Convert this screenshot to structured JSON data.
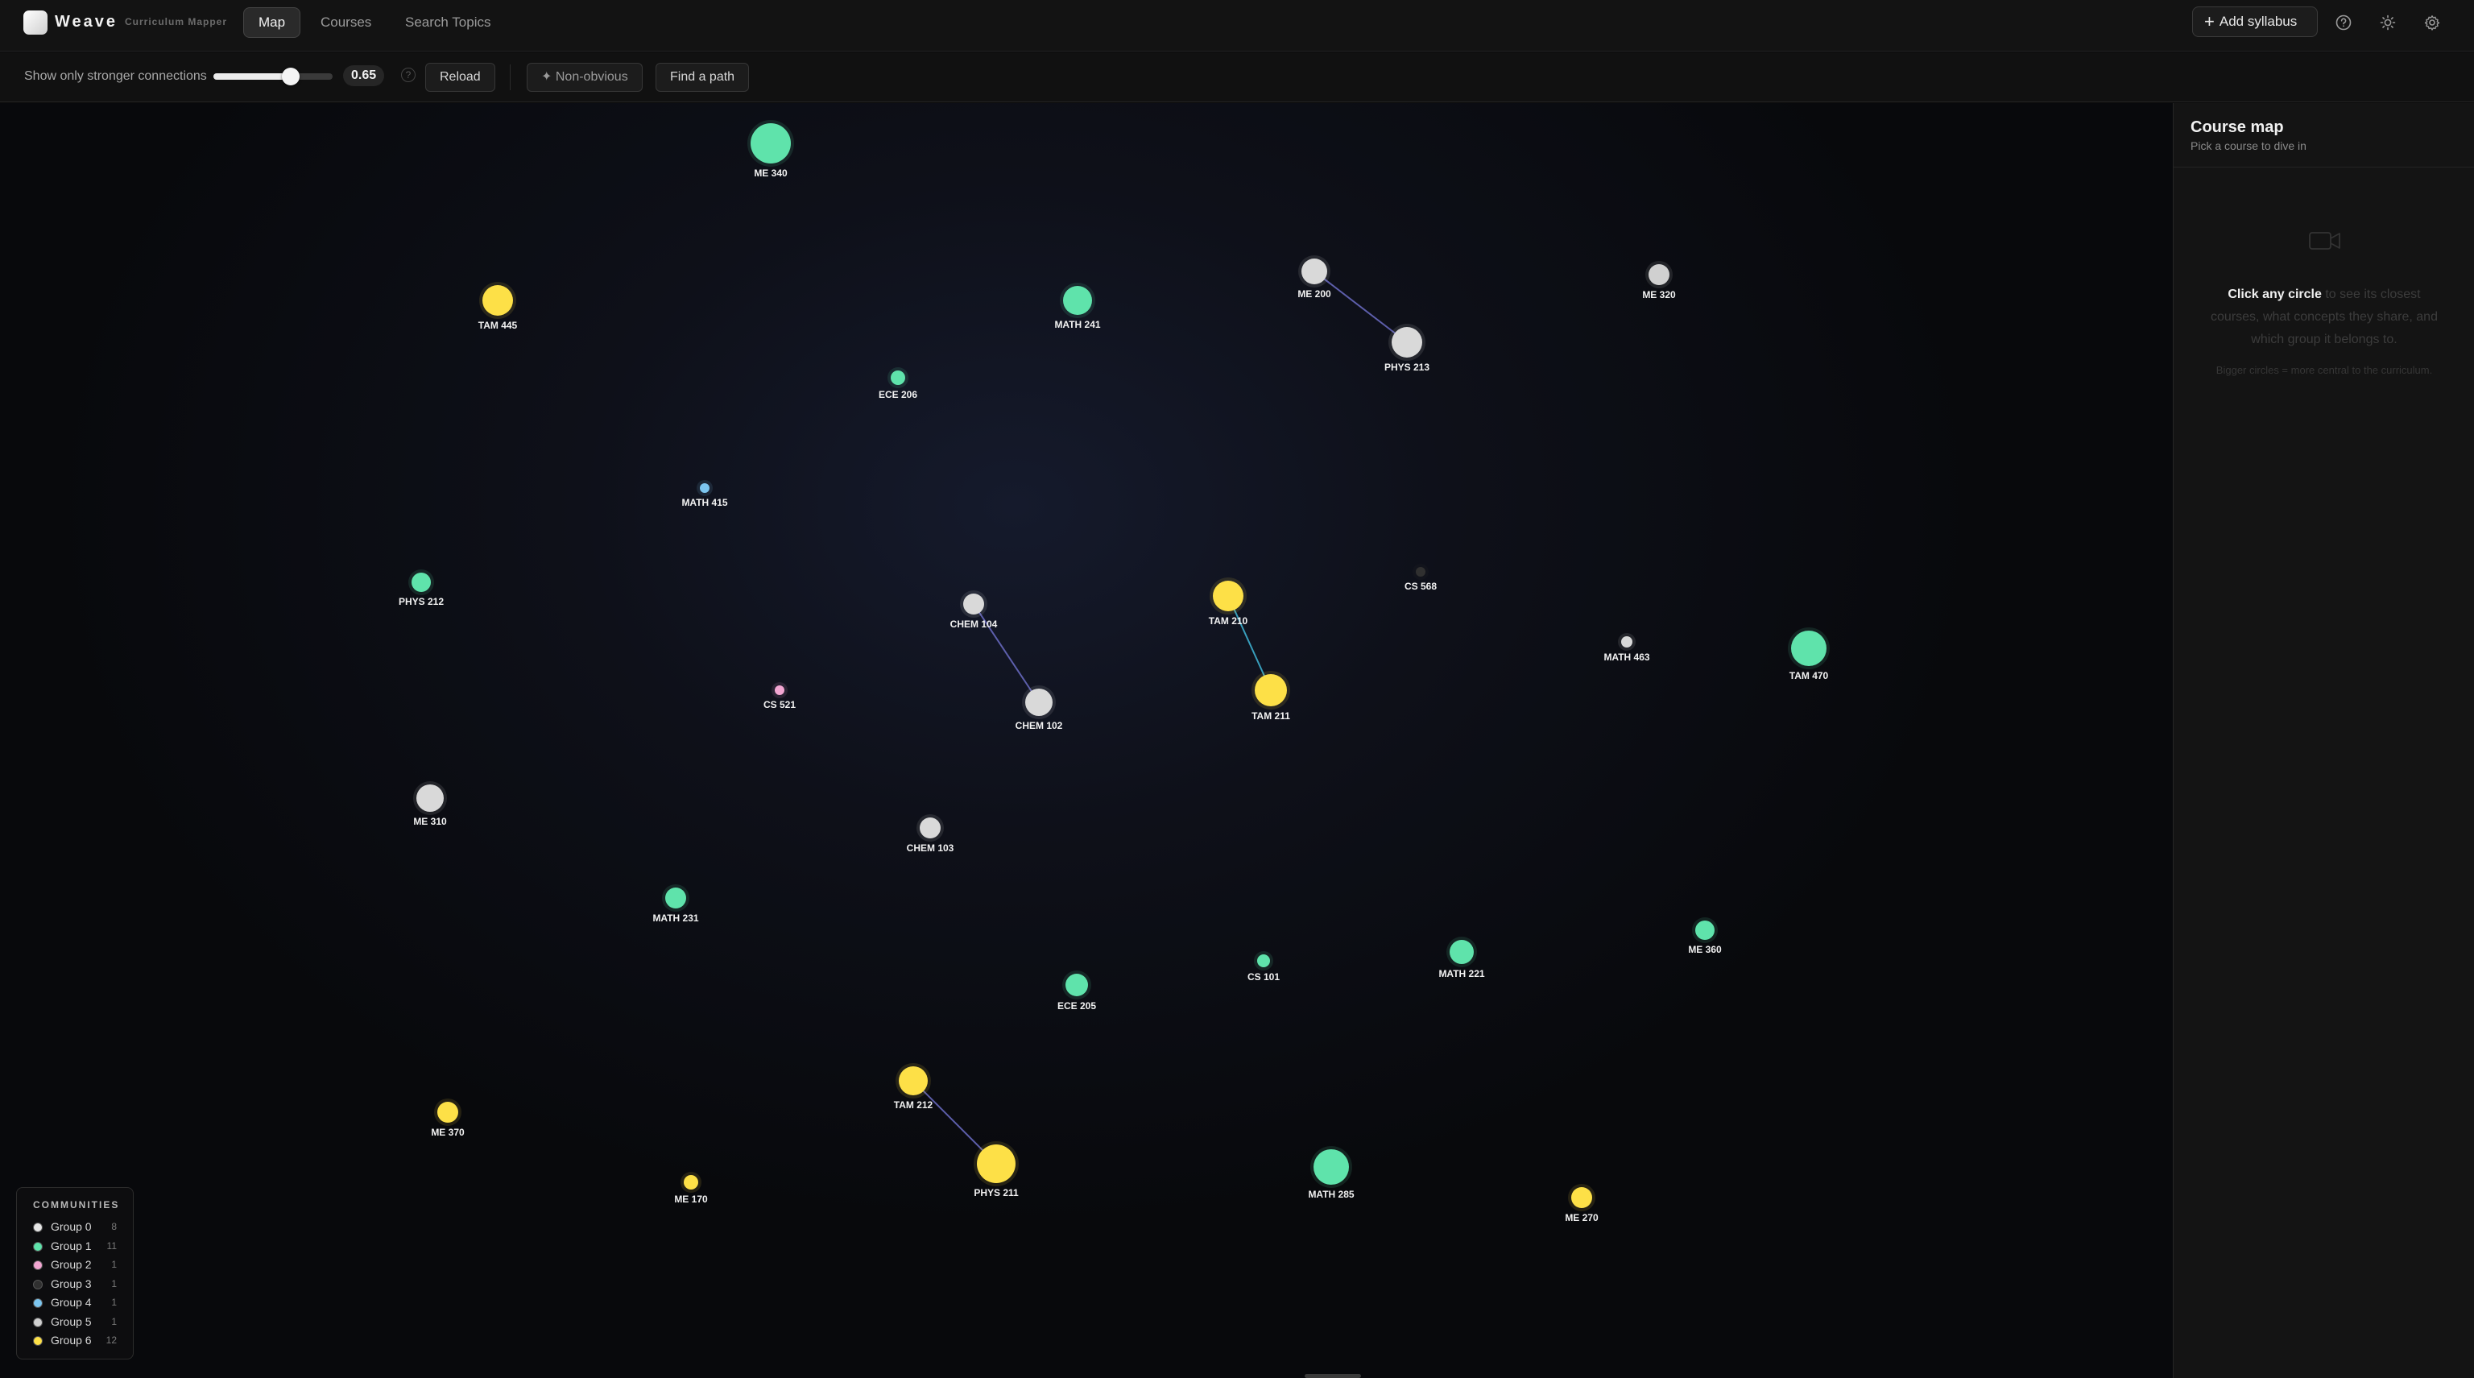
{
  "app": {
    "name": "Weave",
    "subtitle": "Curriculum Mapper"
  },
  "nav": {
    "tabs": [
      {
        "label": "Map",
        "active": true
      },
      {
        "label": "Courses",
        "active": false
      },
      {
        "label": "Search Topics",
        "active": false
      }
    ]
  },
  "header_actions": {
    "add_label": "Add syllabus",
    "icons": [
      "help-icon",
      "sun-icon",
      "settings-icon"
    ]
  },
  "toolbar": {
    "threshold_label": "Show only stronger connections",
    "threshold_value": 0.65,
    "threshold_display": "0.65",
    "help_glyph": "?",
    "reload_label": "Reload",
    "non_obvious_label": "Non-obvious",
    "find_path_label": "Find a path"
  },
  "graph": {
    "colors": {
      "group0": "#d9d9d9",
      "group1": "#5fe3ab",
      "group2": "#f2a6d2",
      "group3": "#303030",
      "group4": "#7cc6f0",
      "group5": "#d0d0d0",
      "group6": "#fde047",
      "edge_purple": "#6b6cc4",
      "edge_cyan": "#3fb7d8"
    },
    "nodes": [
      {
        "id": "ME 340",
        "group": 1
      },
      {
        "id": "TAM 445",
        "group": 6
      },
      {
        "id": "MATH 241",
        "group": 1
      },
      {
        "id": "ME 200",
        "group": 0
      },
      {
        "id": "ME 320",
        "group": 5
      },
      {
        "id": "PHYS 213",
        "group": 0
      },
      {
        "id": "ECE 206",
        "group": 1
      },
      {
        "id": "MATH 415",
        "group": 4
      },
      {
        "id": "PHYS 212",
        "group": 1
      },
      {
        "id": "CHEM 104",
        "group": 0
      },
      {
        "id": "TAM 210",
        "group": 6
      },
      {
        "id": "CS 568",
        "group": 3
      },
      {
        "id": "MATH 463",
        "group": 0
      },
      {
        "id": "TAM 470",
        "group": 1
      },
      {
        "id": "CS 521",
        "group": 2
      },
      {
        "id": "CHEM 102",
        "group": 0
      },
      {
        "id": "TAM 211",
        "group": 6
      },
      {
        "id": "ME 310",
        "group": 0
      },
      {
        "id": "CHEM 103",
        "group": 0
      },
      {
        "id": "MATH 231",
        "group": 1
      },
      {
        "id": "ME 360",
        "group": 1
      },
      {
        "id": "MATH 221",
        "group": 1
      },
      {
        "id": "CS 101",
        "group": 1
      },
      {
        "id": "ECE 205",
        "group": 1
      },
      {
        "id": "TAM 212",
        "group": 6
      },
      {
        "id": "ME 370",
        "group": 6
      },
      {
        "id": "PHYS 211",
        "group": 6
      },
      {
        "id": "MATH 285",
        "group": 1
      },
      {
        "id": "ME 170",
        "group": 6
      },
      {
        "id": "ME 270",
        "group": 6
      }
    ],
    "edges": [
      {
        "source": "ME 200",
        "target": "PHYS 213",
        "color": "edge_purple"
      },
      {
        "source": "CHEM 104",
        "target": "CHEM 102",
        "color": "edge_purple"
      },
      {
        "source": "TAM 210",
        "target": "TAM 211",
        "color": "edge_cyan"
      },
      {
        "source": "TAM 212",
        "target": "PHYS 211",
        "color": "edge_purple"
      }
    ]
  },
  "legend": {
    "title": "COMMUNITIES",
    "items": [
      {
        "name": "Group 0",
        "count": "8",
        "color": "#e6e6e6"
      },
      {
        "name": "Group 1",
        "count": "11",
        "color": "#5fe3ab"
      },
      {
        "name": "Group 2",
        "count": "1",
        "color": "#f2a6d2"
      },
      {
        "name": "Group 3",
        "count": "1",
        "color": "#303030"
      },
      {
        "name": "Group 4",
        "count": "1",
        "color": "#7cc6f0"
      },
      {
        "name": "Group 5",
        "count": "1",
        "color": "#d0d0d0"
      },
      {
        "name": "Group 6",
        "count": "12",
        "color": "#fde047"
      }
    ]
  },
  "panel": {
    "title": "Course map",
    "subtitle": "Pick a course to dive in",
    "icon": "video-camera-icon",
    "message_bold": "Click any circle",
    "message_rest": " to see its closest courses, what concepts they share, and which group it belongs to.",
    "hint": "Bigger circles = more central to the curriculum."
  }
}
